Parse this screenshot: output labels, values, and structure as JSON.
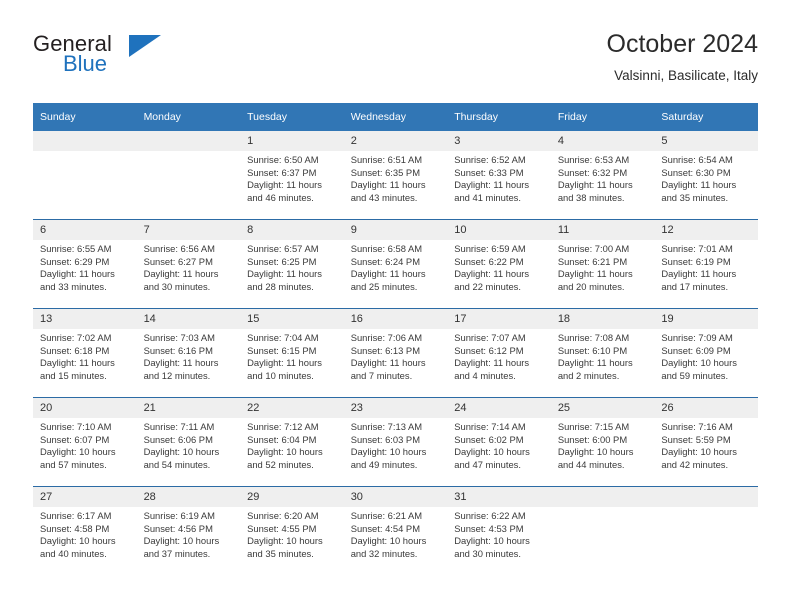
{
  "brand": {
    "name_part1": "General",
    "name_part2": "Blue",
    "triangle_color": "#1f72bd"
  },
  "header": {
    "title": "October 2024",
    "subtitle": "Valsinni, Basilicate, Italy"
  },
  "colors": {
    "header_blue": "#3176b5",
    "row_divider_blue": "#2c6ba5",
    "daynum_band": "#efefef",
    "brand_blue": "#1f72bd"
  },
  "calendar": {
    "weekday_headers": [
      "Sunday",
      "Monday",
      "Tuesday",
      "Wednesday",
      "Thursday",
      "Friday",
      "Saturday"
    ],
    "weeks": [
      [
        {
          "day": "",
          "lines": [
            "",
            "",
            "",
            ""
          ],
          "blank": true
        },
        {
          "day": "",
          "lines": [
            "",
            "",
            "",
            ""
          ],
          "blank": true
        },
        {
          "day": "1",
          "lines": [
            "Sunrise: 6:50 AM",
            "Sunset: 6:37 PM",
            "Daylight: 11 hours",
            "and 46 minutes."
          ]
        },
        {
          "day": "2",
          "lines": [
            "Sunrise: 6:51 AM",
            "Sunset: 6:35 PM",
            "Daylight: 11 hours",
            "and 43 minutes."
          ]
        },
        {
          "day": "3",
          "lines": [
            "Sunrise: 6:52 AM",
            "Sunset: 6:33 PM",
            "Daylight: 11 hours",
            "and 41 minutes."
          ]
        },
        {
          "day": "4",
          "lines": [
            "Sunrise: 6:53 AM",
            "Sunset: 6:32 PM",
            "Daylight: 11 hours",
            "and 38 minutes."
          ]
        },
        {
          "day": "5",
          "lines": [
            "Sunrise: 6:54 AM",
            "Sunset: 6:30 PM",
            "Daylight: 11 hours",
            "and 35 minutes."
          ]
        }
      ],
      [
        {
          "day": "6",
          "lines": [
            "Sunrise: 6:55 AM",
            "Sunset: 6:29 PM",
            "Daylight: 11 hours",
            "and 33 minutes."
          ]
        },
        {
          "day": "7",
          "lines": [
            "Sunrise: 6:56 AM",
            "Sunset: 6:27 PM",
            "Daylight: 11 hours",
            "and 30 minutes."
          ]
        },
        {
          "day": "8",
          "lines": [
            "Sunrise: 6:57 AM",
            "Sunset: 6:25 PM",
            "Daylight: 11 hours",
            "and 28 minutes."
          ]
        },
        {
          "day": "9",
          "lines": [
            "Sunrise: 6:58 AM",
            "Sunset: 6:24 PM",
            "Daylight: 11 hours",
            "and 25 minutes."
          ]
        },
        {
          "day": "10",
          "lines": [
            "Sunrise: 6:59 AM",
            "Sunset: 6:22 PM",
            "Daylight: 11 hours",
            "and 22 minutes."
          ]
        },
        {
          "day": "11",
          "lines": [
            "Sunrise: 7:00 AM",
            "Sunset: 6:21 PM",
            "Daylight: 11 hours",
            "and 20 minutes."
          ]
        },
        {
          "day": "12",
          "lines": [
            "Sunrise: 7:01 AM",
            "Sunset: 6:19 PM",
            "Daylight: 11 hours",
            "and 17 minutes."
          ]
        }
      ],
      [
        {
          "day": "13",
          "lines": [
            "Sunrise: 7:02 AM",
            "Sunset: 6:18 PM",
            "Daylight: 11 hours",
            "and 15 minutes."
          ]
        },
        {
          "day": "14",
          "lines": [
            "Sunrise: 7:03 AM",
            "Sunset: 6:16 PM",
            "Daylight: 11 hours",
            "and 12 minutes."
          ]
        },
        {
          "day": "15",
          "lines": [
            "Sunrise: 7:04 AM",
            "Sunset: 6:15 PM",
            "Daylight: 11 hours",
            "and 10 minutes."
          ]
        },
        {
          "day": "16",
          "lines": [
            "Sunrise: 7:06 AM",
            "Sunset: 6:13 PM",
            "Daylight: 11 hours",
            "and 7 minutes."
          ]
        },
        {
          "day": "17",
          "lines": [
            "Sunrise: 7:07 AM",
            "Sunset: 6:12 PM",
            "Daylight: 11 hours",
            "and 4 minutes."
          ]
        },
        {
          "day": "18",
          "lines": [
            "Sunrise: 7:08 AM",
            "Sunset: 6:10 PM",
            "Daylight: 11 hours",
            "and 2 minutes."
          ]
        },
        {
          "day": "19",
          "lines": [
            "Sunrise: 7:09 AM",
            "Sunset: 6:09 PM",
            "Daylight: 10 hours",
            "and 59 minutes."
          ]
        }
      ],
      [
        {
          "day": "20",
          "lines": [
            "Sunrise: 7:10 AM",
            "Sunset: 6:07 PM",
            "Daylight: 10 hours",
            "and 57 minutes."
          ]
        },
        {
          "day": "21",
          "lines": [
            "Sunrise: 7:11 AM",
            "Sunset: 6:06 PM",
            "Daylight: 10 hours",
            "and 54 minutes."
          ]
        },
        {
          "day": "22",
          "lines": [
            "Sunrise: 7:12 AM",
            "Sunset: 6:04 PM",
            "Daylight: 10 hours",
            "and 52 minutes."
          ]
        },
        {
          "day": "23",
          "lines": [
            "Sunrise: 7:13 AM",
            "Sunset: 6:03 PM",
            "Daylight: 10 hours",
            "and 49 minutes."
          ]
        },
        {
          "day": "24",
          "lines": [
            "Sunrise: 7:14 AM",
            "Sunset: 6:02 PM",
            "Daylight: 10 hours",
            "and 47 minutes."
          ]
        },
        {
          "day": "25",
          "lines": [
            "Sunrise: 7:15 AM",
            "Sunset: 6:00 PM",
            "Daylight: 10 hours",
            "and 44 minutes."
          ]
        },
        {
          "day": "26",
          "lines": [
            "Sunrise: 7:16 AM",
            "Sunset: 5:59 PM",
            "Daylight: 10 hours",
            "and 42 minutes."
          ]
        }
      ],
      [
        {
          "day": "27",
          "lines": [
            "Sunrise: 6:17 AM",
            "Sunset: 4:58 PM",
            "Daylight: 10 hours",
            "and 40 minutes."
          ]
        },
        {
          "day": "28",
          "lines": [
            "Sunrise: 6:19 AM",
            "Sunset: 4:56 PM",
            "Daylight: 10 hours",
            "and 37 minutes."
          ]
        },
        {
          "day": "29",
          "lines": [
            "Sunrise: 6:20 AM",
            "Sunset: 4:55 PM",
            "Daylight: 10 hours",
            "and 35 minutes."
          ]
        },
        {
          "day": "30",
          "lines": [
            "Sunrise: 6:21 AM",
            "Sunset: 4:54 PM",
            "Daylight: 10 hours",
            "and 32 minutes."
          ]
        },
        {
          "day": "31",
          "lines": [
            "Sunrise: 6:22 AM",
            "Sunset: 4:53 PM",
            "Daylight: 10 hours",
            "and 30 minutes."
          ]
        },
        {
          "day": "",
          "lines": [
            "",
            "",
            "",
            ""
          ],
          "blank": true
        },
        {
          "day": "",
          "lines": [
            "",
            "",
            "",
            ""
          ],
          "blank": true
        }
      ]
    ]
  }
}
